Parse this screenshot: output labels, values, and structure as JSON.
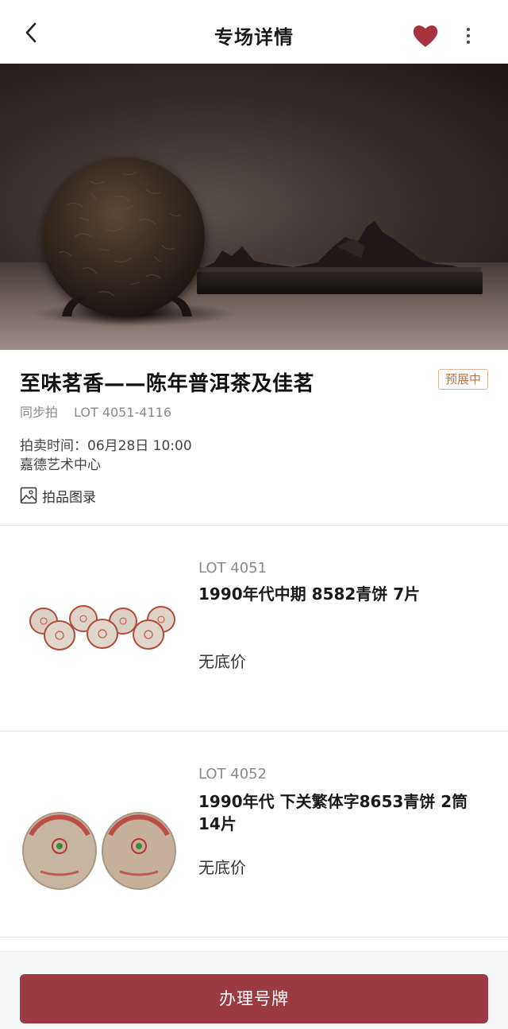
{
  "header": {
    "title": "专场详情",
    "back_icon": "chevron-left-icon",
    "favorite_icon": "heart-icon",
    "more_icon": "vertical-dots-icon",
    "favorite_color": "#a8323e"
  },
  "sale": {
    "title": "至味茗香——陈年普洱茶及佳茗",
    "status": "预展中",
    "type": "同步拍",
    "lot_range": "LOT 4051-4116",
    "time": "拍卖时间：06月28日 10:00",
    "venue": "嘉德艺术中心",
    "catalog_label": "拍品图录",
    "catalog_icon": "image-icon"
  },
  "lots": [
    {
      "lot_no": "LOT 4051",
      "name": "1990年代中期 8582青饼  7片",
      "price": "无底价"
    },
    {
      "lot_no": "LOT 4052",
      "name": "1990年代 下关繁体字8653青饼  2筒14片",
      "price": "无底价"
    }
  ],
  "footer": {
    "register_label": "办理号牌",
    "button_color": "#9c3a44"
  }
}
